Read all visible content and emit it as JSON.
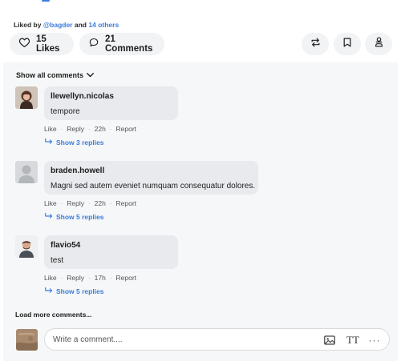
{
  "post": {
    "liked_by_prefix": "Liked by",
    "liked_by_user": "@bagder",
    "liked_by_and": "and",
    "liked_by_others": "14 others"
  },
  "actions": {
    "likes_label": "15 Likes",
    "comments_label": "21 Comments",
    "icons": [
      "heart-icon",
      "speech-bubble-icon",
      "repost-icon",
      "bookmark-icon",
      "share-icon"
    ]
  },
  "comments_section": {
    "show_all_label": "Show all comments",
    "load_more_label": "Load more comments...",
    "items": [
      {
        "user": "llewellyn.nicolas",
        "text": "tempore",
        "like_label": "Like",
        "reply_label": "Reply",
        "time": "22h",
        "report_label": "Report",
        "replies_label": "Show 3 replies"
      },
      {
        "user": "braden.howell",
        "text": "Magni sed autem eveniet numquam consequatur dolores.",
        "like_label": "Like",
        "reply_label": "Reply",
        "time": "22h",
        "report_label": "Report",
        "replies_label": "Show 5 replies"
      },
      {
        "user": "flavio54",
        "text": "test",
        "like_label": "Like",
        "reply_label": "Reply",
        "time": "17h",
        "report_label": "Report",
        "replies_label": "Show 5 replies"
      }
    ]
  },
  "composer": {
    "placeholder": "Write a comment....",
    "text_tool_label": "TT",
    "more_label": "···"
  },
  "colors": {
    "link": "#3b7ddd",
    "panel_background": "#f6f7f8",
    "bubble_background": "#e8eaed",
    "pill_background": "#f2f3f5"
  }
}
